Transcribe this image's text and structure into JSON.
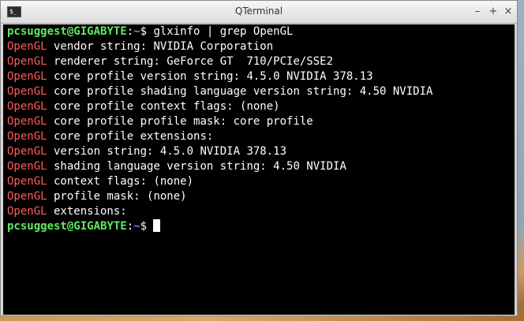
{
  "window": {
    "title": "QTerminal",
    "app_icon_text": "$_",
    "buttons": {
      "minimize": "–",
      "maximize": "+",
      "close": "×"
    }
  },
  "prompt": {
    "user_host": "pcsuggest@GIGABYTE",
    "separator": ":",
    "path": "~",
    "sign": "$ "
  },
  "command": "glxinfo | grep OpenGL",
  "match_word": "OpenGL",
  "output": [
    " vendor string: NVIDIA Corporation",
    " renderer string: GeForce GT  710/PCIe/SSE2",
    " core profile version string: 4.5.0 NVIDIA 378.13",
    " core profile shading language version string: 4.50 NVIDIA",
    " core profile context flags: (none)",
    " core profile profile mask: core profile",
    " core profile extensions:",
    " version string: 4.5.0 NVIDIA 378.13",
    " shading language version string: 4.50 NVIDIA",
    " context flags: (none)",
    " profile mask: (none)",
    " extensions:"
  ],
  "colors": {
    "background": "#000000",
    "prompt_user": "#62e862",
    "prompt_path": "#6f86ff",
    "match": "#ff5a5a",
    "text": "#ffffff"
  }
}
